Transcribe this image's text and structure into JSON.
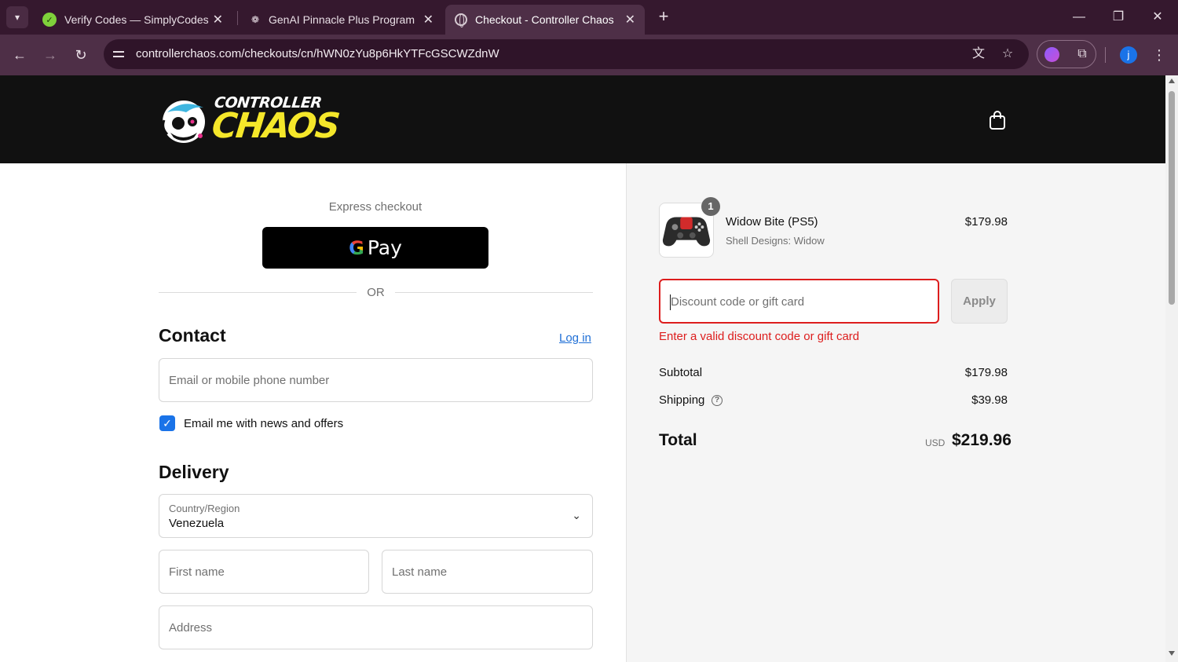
{
  "browser": {
    "tabs": [
      {
        "title": "Verify Codes — SimplyCodes",
        "favicon": "simplycodes-icon",
        "active": false
      },
      {
        "title": "GenAI Pinnacle Plus Program",
        "favicon": "generic-site-icon",
        "active": false
      },
      {
        "title": "Checkout - Controller Chaos",
        "favicon": "globe-icon",
        "active": true
      }
    ],
    "url": "controllerchaos.com/checkouts/cn/hWN0zYu8p6HkYTFcGSCWZdnW",
    "profile_initial": "j",
    "accent": "#4e2f47"
  },
  "store": {
    "logo_top": "CONTROLLER",
    "logo_bottom": "CHAOS",
    "logo_color": "#f5e72a"
  },
  "express": {
    "label": "Express checkout",
    "gpay_g": "G",
    "gpay_text": "Pay",
    "or": "OR"
  },
  "contact": {
    "title": "Contact",
    "login": "Log in",
    "email_placeholder": "Email or mobile phone number",
    "newsletter_label": "Email me with news and offers",
    "newsletter_checked": true
  },
  "delivery": {
    "title": "Delivery",
    "country_label": "Country/Region",
    "country_value": "Venezuela",
    "first_name_placeholder": "First name",
    "last_name_placeholder": "Last name",
    "address_placeholder": "Address"
  },
  "summary": {
    "item": {
      "quantity": "1",
      "name": "Widow Bite (PS5)",
      "variant": "Shell Designs: Widow",
      "price": "$179.98"
    },
    "discount_placeholder": "Discount code or gift card",
    "apply": "Apply",
    "error": "Enter a valid discount code or gift card",
    "error_color": "#dd1d1d",
    "subtotal_label": "Subtotal",
    "subtotal_value": "$179.98",
    "shipping_label": "Shipping",
    "shipping_value": "$39.98",
    "total_label": "Total",
    "total_currency": "USD",
    "total_value": "$219.96"
  }
}
